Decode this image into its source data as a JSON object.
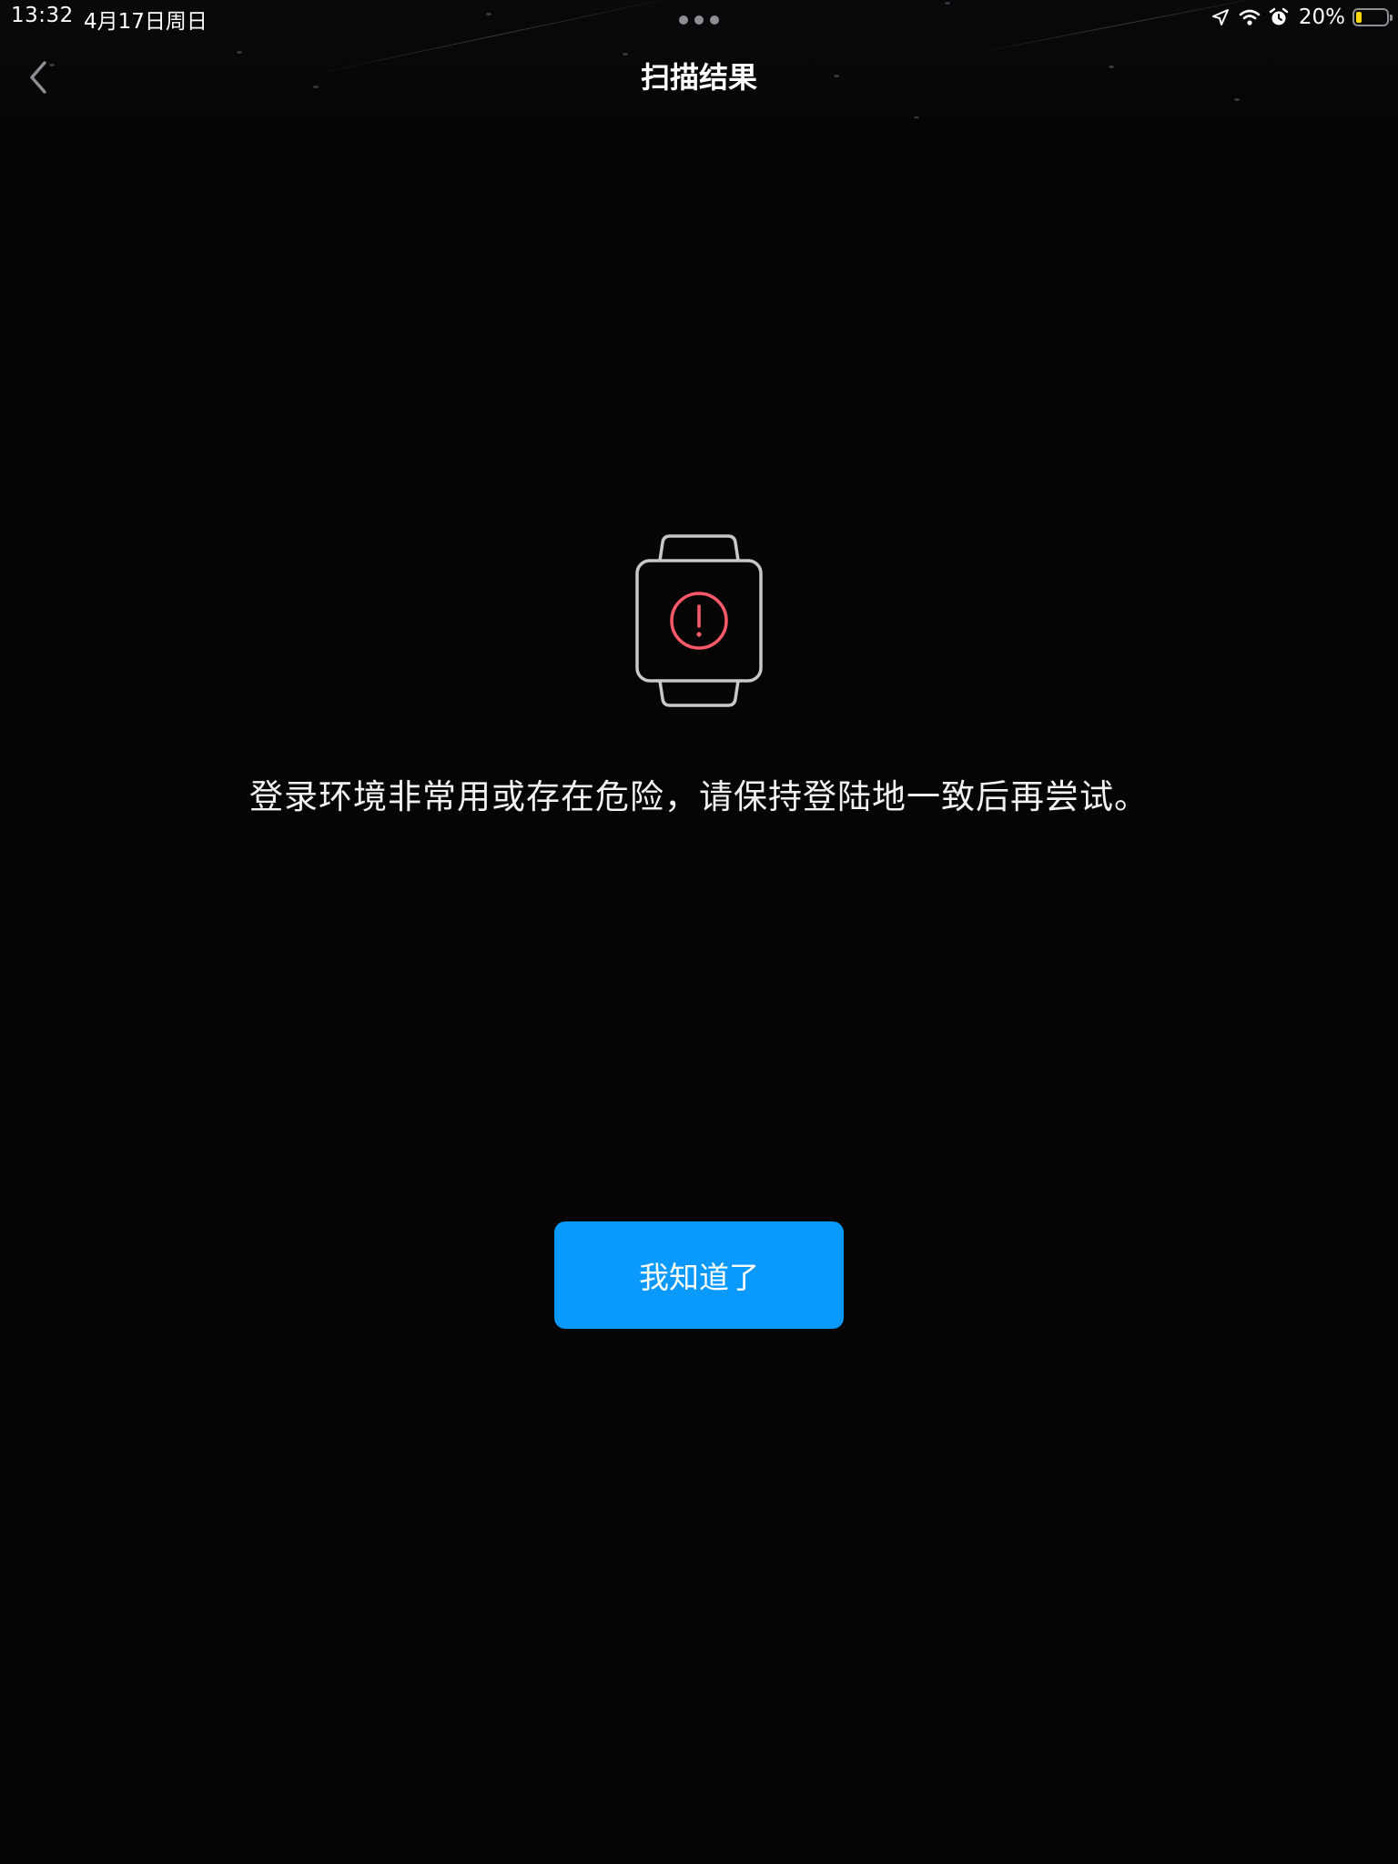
{
  "status_bar": {
    "time": "13:32",
    "date": "4月17日周日",
    "battery_percent_text": "20%",
    "battery_level": 0.2,
    "icons": [
      "location-arrow-icon",
      "wifi-icon",
      "alarm-icon",
      "battery-icon"
    ]
  },
  "nav": {
    "title": "扫描结果",
    "back_icon": "chevron-left-icon"
  },
  "result": {
    "icon": "watch-warning-icon",
    "message": "登录环境非常用或存在危险，请保持登陆地一致后再尝试。"
  },
  "actions": {
    "confirm_label": "我知道了"
  },
  "colors": {
    "background": "#050506",
    "accent": "#0a99ff",
    "warning": "#ff5a6a",
    "icon_outline": "#c8c8c8",
    "battery_low": "#ffd60a"
  }
}
